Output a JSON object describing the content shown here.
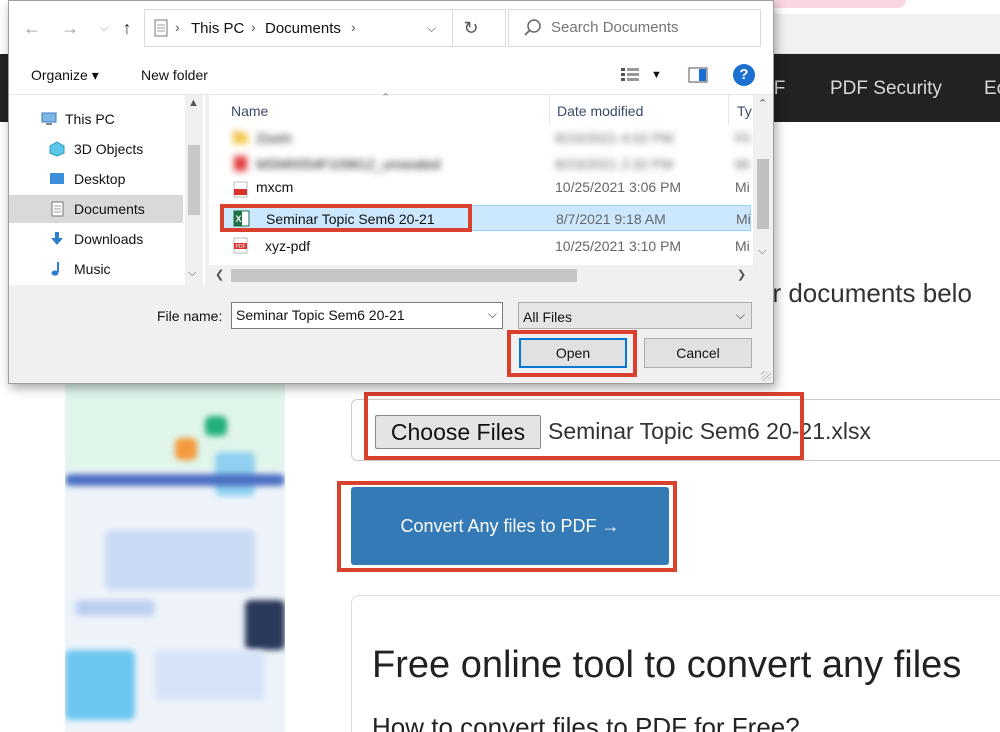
{
  "page": {
    "nav": [
      {
        "label": "DF"
      },
      {
        "label": "PDF Security"
      },
      {
        "label": "Ec"
      }
    ],
    "lede": "ur documents belo",
    "lede_tail": ":",
    "choose_files_label": "Choose Files",
    "chosen_file": "Seminar Topic Sem6 20-21.xlsx",
    "convert_label": "Convert Any files to PDF →",
    "info_title": "Free online tool to convert any files",
    "info_subtitle": "How to convert files to PDF for Free?"
  },
  "dialog": {
    "path": [
      "This PC",
      "Documents"
    ],
    "search_placeholder": "Search Documents",
    "toolbar": {
      "organize": "Organize ▾",
      "new_folder": "New folder",
      "help": "?"
    },
    "nav_items": [
      {
        "label": "This PC",
        "icon": "computer-icon"
      },
      {
        "label": "3D Objects",
        "icon": "cube-icon"
      },
      {
        "label": "Desktop",
        "icon": "desktop-icon"
      },
      {
        "label": "Documents",
        "icon": "documents-icon",
        "selected": true
      },
      {
        "label": "Downloads",
        "icon": "download-arrow-icon"
      },
      {
        "label": "Music",
        "icon": "music-note-icon"
      }
    ],
    "columns": {
      "name": "Name",
      "date": "Date modified",
      "type": "Ty"
    },
    "files": [
      {
        "name": "Zoom",
        "date": "8/10/2021 4:02 PM",
        "type": "Fil",
        "icon": "folder-icon",
        "blurred": true
      },
      {
        "name": "MSM0054F109612_unseated",
        "date": "8/23/2021 2:32 PM",
        "type": "Mi",
        "icon": "pdf-icon",
        "blurred": true
      },
      {
        "name": "mxcm",
        "date": "10/25/2021 3:06 PM",
        "type": "Mi",
        "icon": "pdf-icon",
        "blurred": false
      },
      {
        "name": "Seminar Topic Sem6 20-21",
        "date": "8/7/2021 9:18 AM",
        "type": "Mi",
        "icon": "excel-icon",
        "selected": true
      },
      {
        "name": "xyz-pdf",
        "date": "10/25/2021 3:10 PM",
        "type": "Mi",
        "icon": "pdf-icon"
      }
    ],
    "file_name_label": "File name:",
    "file_name_value": "Seminar Topic Sem6 20-21",
    "file_type": "All Files",
    "open_label": "Open",
    "cancel_label": "Cancel"
  },
  "colors": {
    "annotation": "#d9412e",
    "convert_button": "#337ab7",
    "selection": "#cce8ff",
    "navbar": "#222222"
  }
}
